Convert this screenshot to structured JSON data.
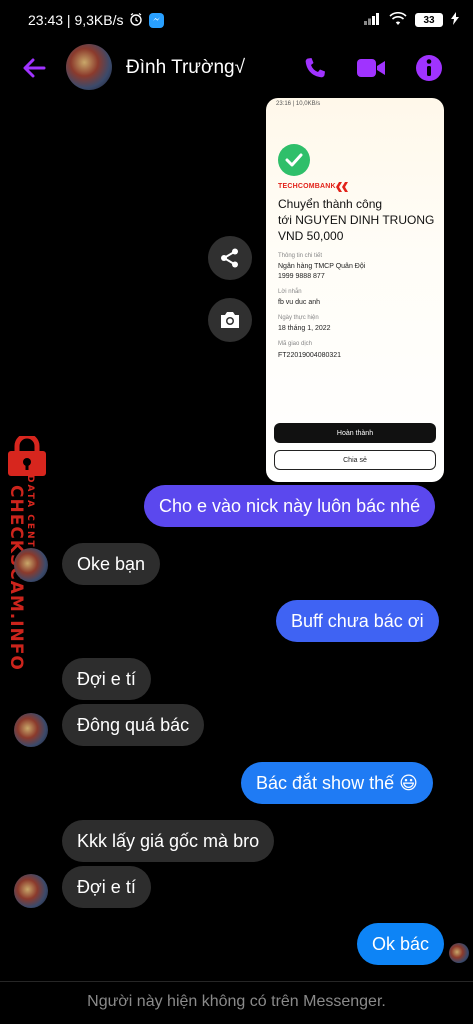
{
  "status_bar": {
    "time_speed": "23:43 | 9,3KB/s",
    "battery": "33"
  },
  "header": {
    "contact_name": "Đình Trường√",
    "icons": [
      "back-arrow-icon",
      "phone-icon",
      "video-icon",
      "info-icon"
    ],
    "accent_color": "#a033ff"
  },
  "attachment": {
    "status_text": "23:16 | 10,0KB/s",
    "bank": "TECHCOMBANK",
    "title_line1": "Chuyển thành công",
    "title_line2": "tới NGUYEN DINH TRUONG",
    "title_line3": "VND 50,000",
    "details_label": "Thông tin chi tiết",
    "bank_name": "Ngân hàng TMCP Quân Đội",
    "account": "1999 9888 877",
    "note_label": "Lời nhắn",
    "note": "fb vu duc anh",
    "date_label": "Ngày thực hiện",
    "date": "18 tháng 1, 2022",
    "txn_label": "Mã giao dịch",
    "txn": "FT22019004080321",
    "btn_done": "Hoàn thành",
    "btn_share": "Chia sẻ"
  },
  "messages": [
    {
      "from": "me",
      "text": "Cho e vào nick này luôn bác nhé"
    },
    {
      "from": "them",
      "text": "Oke bạn"
    },
    {
      "from": "me",
      "text": "Buff chưa bác ơi"
    },
    {
      "from": "them",
      "text": "Đợi e tí"
    },
    {
      "from": "them",
      "text": "Đông quá bác"
    },
    {
      "from": "me",
      "text": "Bác đắt show thế 😃"
    },
    {
      "from": "them",
      "text": "Kkk lấy giá gốc mà bro"
    },
    {
      "from": "them",
      "text": "Đợi e tí"
    },
    {
      "from": "me",
      "text": "Ok bác"
    }
  ],
  "watermark": {
    "main": "CHECKSCAM.INFO",
    "sub": "DATA CENTER"
  },
  "footer": {
    "text": "Người này hiện không có trên Messenger."
  }
}
